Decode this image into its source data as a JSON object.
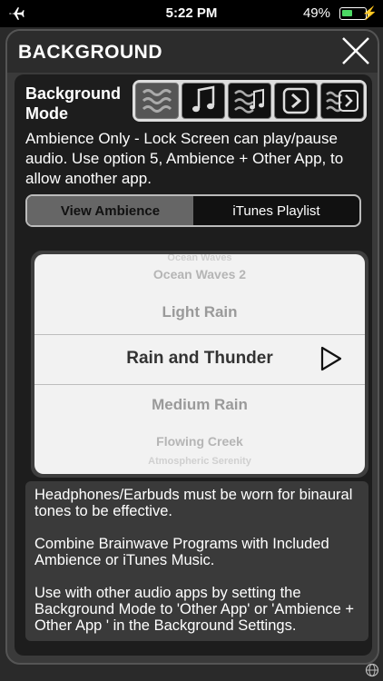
{
  "status_bar": {
    "time": "5:22 PM",
    "battery_percent": "49%",
    "battery_level": 0.49,
    "icons": [
      "airplane-icon",
      "battery-icon",
      "charging-bolt-icon"
    ]
  },
  "panel": {
    "title": "BACKGROUND",
    "close_icon": "close-icon"
  },
  "background_mode": {
    "label": "Background Mode",
    "options": [
      {
        "icon": "waves-icon",
        "active": true
      },
      {
        "icon": "music-note-icon",
        "active": false
      },
      {
        "icon": "waves-music-icon",
        "active": false
      },
      {
        "icon": "forward-app-icon",
        "active": false
      },
      {
        "icon": "waves-forward-app-icon",
        "active": false
      }
    ],
    "description": "Ambience Only - Lock Screen can play/pause audio. Use option 5, Ambience + Other App, to allow another app."
  },
  "source_tabs": {
    "tabs": [
      "View Ambience",
      "iTunes Playlist"
    ],
    "selected": "View Ambience"
  },
  "picker": {
    "items": [
      "Ocean Waves",
      "Ocean Waves 2",
      "Light Rain",
      "Rain and Thunder",
      "Medium Rain",
      "Flowing Creek",
      "Atmospheric Serenity"
    ],
    "selected": "Rain and Thunder",
    "play_icon": "play-icon"
  },
  "info": {
    "paragraphs": [
      "Headphones/Earbuds must be worn for binaural tones to be effective.",
      "Combine Brainwave Programs with Included Ambience or iTunes Music.",
      "Use with other audio apps by setting the Background Mode to 'Other App' or 'Ambience + Other App ' in the Background Settings."
    ]
  }
}
